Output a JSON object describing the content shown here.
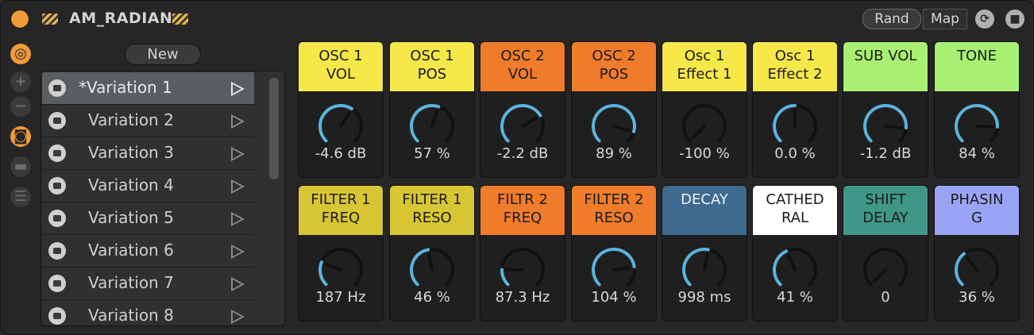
{
  "device": {
    "title": "AM_RADIAN",
    "rand_label": "Rand",
    "map_label": "Map",
    "colors": {
      "accent": "#f19a39",
      "background": "#262626"
    }
  },
  "header_icons": [
    "power-icon",
    "refresh-icon",
    "save-icon"
  ],
  "side_icons": [
    "variation-logo-icon",
    "plus-icon",
    "minus-icon",
    "camera-icon",
    "recall-icon",
    "list-icon"
  ],
  "variations": {
    "new_label": "New",
    "items": [
      "*Variation 1",
      "Variation 2",
      "Variation 3",
      "Variation 4",
      "Variation 5",
      "Variation 6",
      "Variation 7",
      "Variation 8"
    ]
  },
  "macros": [
    {
      "name": "OSC 1\nVOL",
      "value": "-4.6 dB",
      "color": "#f7e84a",
      "level": 0.62
    },
    {
      "name": "OSC 1\nPOS",
      "value": "57 %",
      "color": "#f7e84a",
      "level": 0.57
    },
    {
      "name": "OSC 2\nVOL",
      "value": "-2.2 dB",
      "color": "#ef7c2a",
      "level": 0.72
    },
    {
      "name": "OSC 2\nPOS",
      "value": "89 %",
      "color": "#ef7c2a",
      "level": 0.89
    },
    {
      "name": "Osc 1\nEffect 1",
      "value": "-100 %",
      "color": "#f7e84a",
      "level": 0.0
    },
    {
      "name": "Osc 1\nEffect 2",
      "value": "0.0 %",
      "color": "#f7e84a",
      "level": 0.5
    },
    {
      "name": "SUB  VOL",
      "value": "-1.2 dB",
      "color": "#a8f072",
      "level": 0.85
    },
    {
      "name": "TONE",
      "value": "84 %",
      "color": "#a8f072",
      "level": 0.84
    },
    {
      "name": "FILTER 1\nFREQ",
      "value": "187 Hz",
      "color": "#d8c634",
      "level": 0.25
    },
    {
      "name": "FILTER 1\nRESO",
      "value": "46 %",
      "color": "#d8c634",
      "level": 0.46
    },
    {
      "name": "FILTR 2\nFREQ",
      "value": "87.3 Hz",
      "color": "#ef7c2a",
      "level": 0.17
    },
    {
      "name": "FILTER 2\nRESO",
      "value": "104 %",
      "color": "#ef7c2a",
      "level": 0.8
    },
    {
      "name": "DECAY",
      "value": "998 ms",
      "color": "#3e6a90",
      "level": 0.54
    },
    {
      "name": "CATHED\nRAL",
      "value": "41 %",
      "color": "#ffffff",
      "level": 0.41
    },
    {
      "name": "SHIFT\nDELAY",
      "value": "0",
      "color": "#3f9787",
      "level": 0.0
    },
    {
      "name": "PHASIN\nG",
      "value": "36 %",
      "color": "#99a4f4",
      "level": 0.36
    }
  ]
}
